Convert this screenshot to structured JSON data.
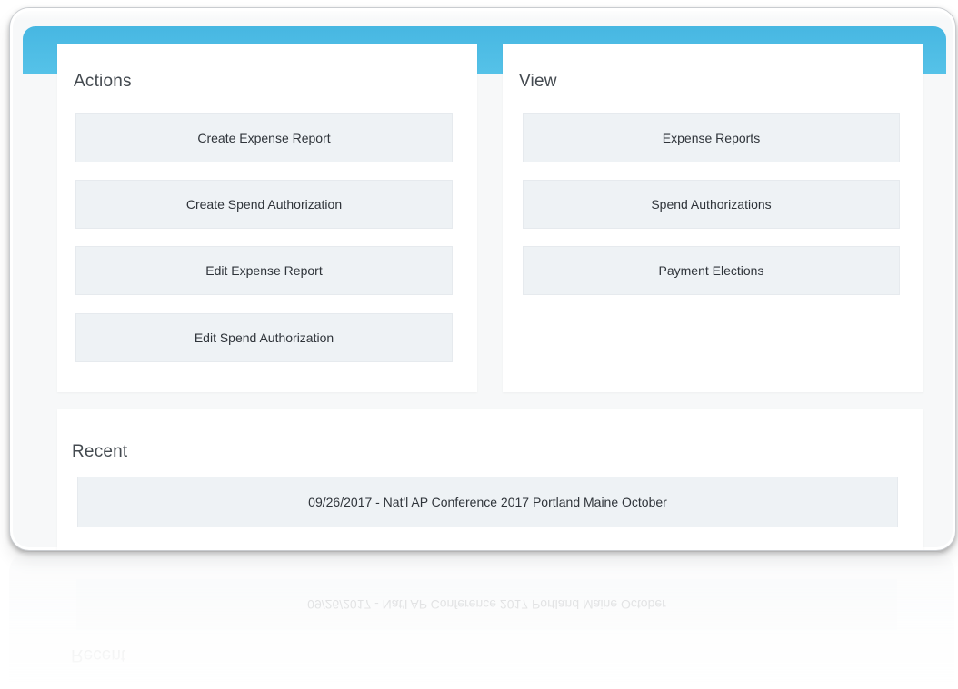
{
  "actions": {
    "title": "Actions",
    "buttons": [
      {
        "label": "Create Expense Report"
      },
      {
        "label": "Create Spend Authorization"
      },
      {
        "label": "Edit Expense Report"
      },
      {
        "label": "Edit Spend Authorization"
      }
    ]
  },
  "view": {
    "title": "View",
    "buttons": [
      {
        "label": "Expense Reports"
      },
      {
        "label": "Spend Authorizations"
      },
      {
        "label": "Payment Elections"
      }
    ]
  },
  "recent": {
    "title": "Recent",
    "items": [
      {
        "label": "09/26/2017 - Nat'l AP Conference 2017 Portland Maine October"
      }
    ]
  },
  "colors": {
    "accent": "#4fbde6",
    "button_bg": "#eef2f5",
    "card_bg": "#ffffff",
    "text": "#2f343a"
  }
}
